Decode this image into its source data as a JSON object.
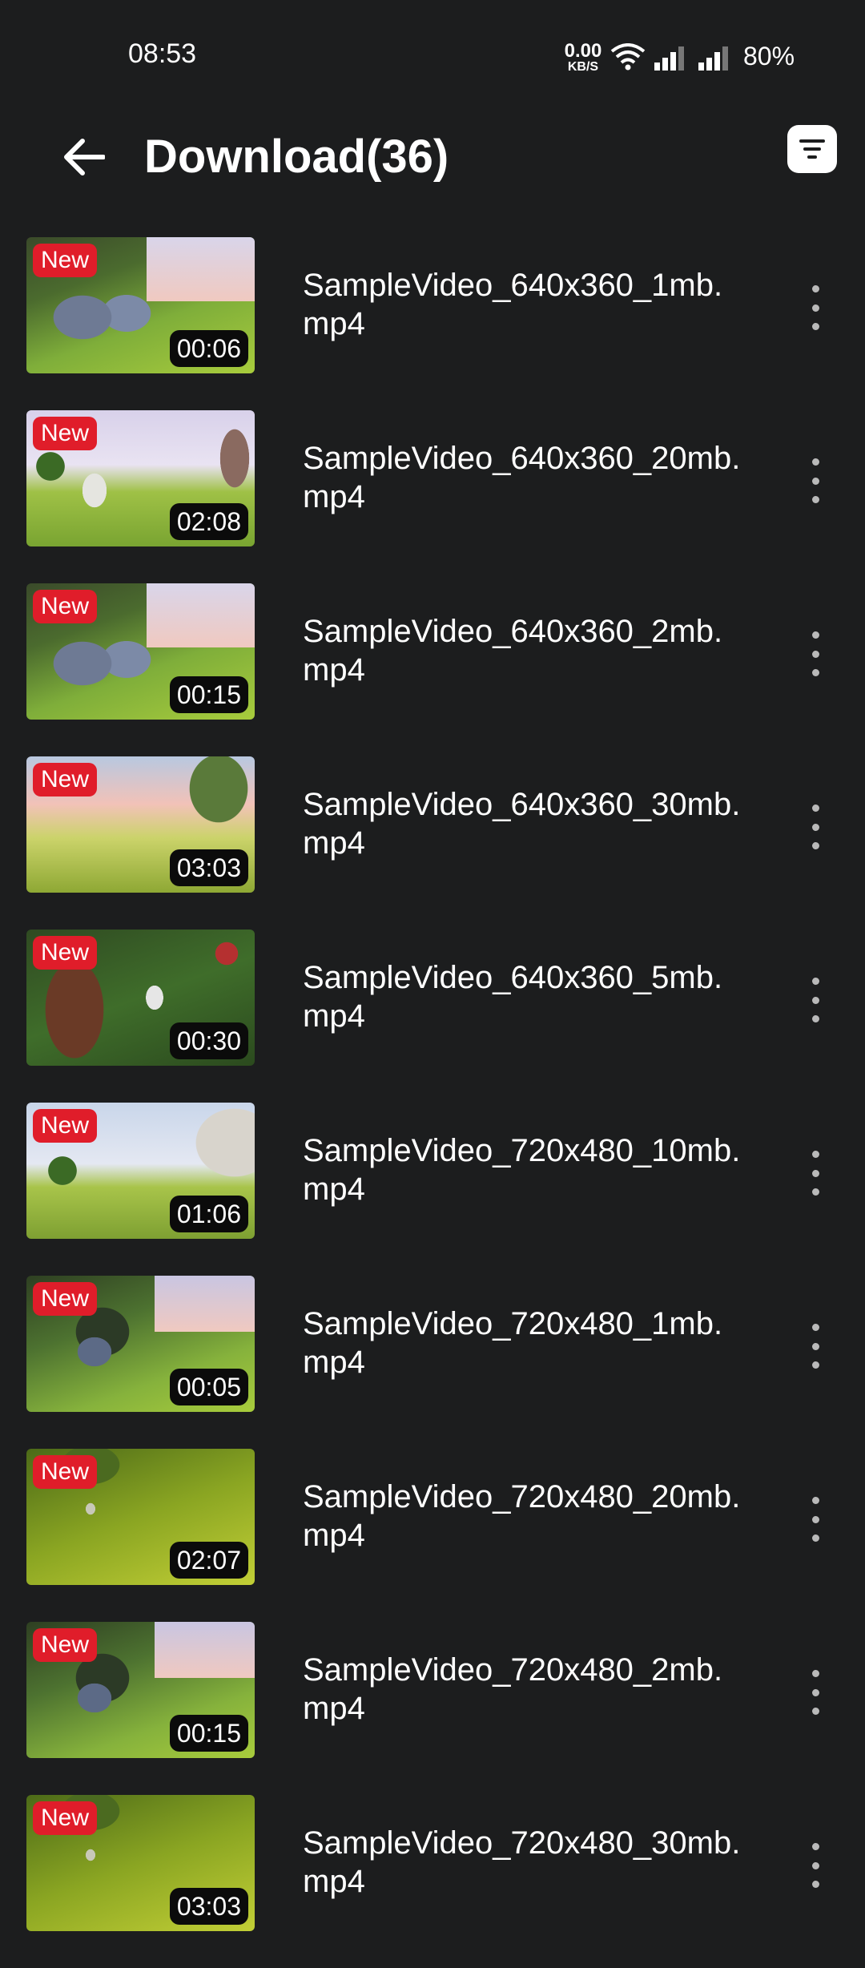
{
  "status_bar": {
    "time": "08:53",
    "net_speed_value": "0.00",
    "net_speed_unit": "KB/S",
    "battery": "80%"
  },
  "header": {
    "title": "Download(36)",
    "back_icon": "arrow-left-icon",
    "filter_icon": "filter-list-icon"
  },
  "colors": {
    "background": "#1c1d1e",
    "new_badge": "#e01d2a"
  },
  "videos": [
    {
      "badge": "New",
      "duration": "00:06",
      "name": "SampleVideo_640x360_1mb.\nmp4"
    },
    {
      "badge": "New",
      "duration": "02:08",
      "name": "SampleVideo_640x360_20mb.\nmp4"
    },
    {
      "badge": "New",
      "duration": "00:15",
      "name": "SampleVideo_640x360_2mb.\nmp4"
    },
    {
      "badge": "New",
      "duration": "03:03",
      "name": "SampleVideo_640x360_30mb.\nmp4"
    },
    {
      "badge": "New",
      "duration": "00:30",
      "name": "SampleVideo_640x360_5mb.\nmp4"
    },
    {
      "badge": "New",
      "duration": "01:06",
      "name": "SampleVideo_720x480_10mb.\nmp4"
    },
    {
      "badge": "New",
      "duration": "00:05",
      "name": "SampleVideo_720x480_1mb.\nmp4"
    },
    {
      "badge": "New",
      "duration": "02:07",
      "name": "SampleVideo_720x480_20mb.\nmp4"
    },
    {
      "badge": "New",
      "duration": "00:15",
      "name": "SampleVideo_720x480_2mb.\nmp4"
    },
    {
      "badge": "New",
      "duration": "03:03",
      "name": "SampleVideo_720x480_30mb.\nmp4"
    }
  ]
}
